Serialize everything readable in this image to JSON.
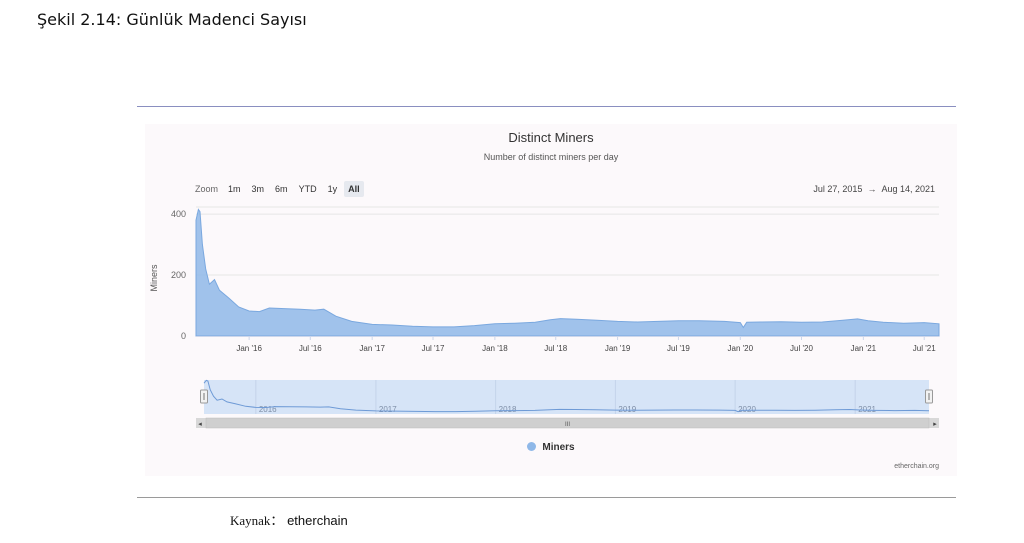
{
  "figure": {
    "caption": "Şekil 2.14: Günlük Madenci Sayısı",
    "source_label": "Kaynak：",
    "source_name": "etherchain"
  },
  "chart_data": {
    "type": "area",
    "title": "Distinct Miners",
    "subtitle": "Number of distinct miners per day",
    "xlabel": "",
    "ylabel": "Miners",
    "yticks": [
      "0",
      "200",
      "400"
    ],
    "ylim": [
      0,
      420
    ],
    "xlim": [
      "2015-07-27",
      "2021-08-14"
    ],
    "xticks": [
      {
        "label": "Jan '16",
        "x": "2016-01-01"
      },
      {
        "label": "Jul '16",
        "x": "2016-07-01"
      },
      {
        "label": "Jan '17",
        "x": "2017-01-01"
      },
      {
        "label": "Jul '17",
        "x": "2017-07-01"
      },
      {
        "label": "Jan '18",
        "x": "2018-01-01"
      },
      {
        "label": "Jul '18",
        "x": "2018-07-01"
      },
      {
        "label": "Jan '19",
        "x": "2019-01-01"
      },
      {
        "label": "Jul '19",
        "x": "2019-07-01"
      },
      {
        "label": "Jan '20",
        "x": "2020-01-01"
      },
      {
        "label": "Jul '20",
        "x": "2020-07-01"
      },
      {
        "label": "Jan '21",
        "x": "2021-01-01"
      },
      {
        "label": "Jul '21",
        "x": "2021-07-01"
      }
    ],
    "navigator_years": [
      "2016",
      "2017",
      "2018",
      "2019",
      "2020",
      "2021"
    ],
    "series": [
      {
        "name": "Miners",
        "color": "#8fb8e8",
        "points": [
          [
            "2015-07-27",
            380
          ],
          [
            "2015-08-03",
            415
          ],
          [
            "2015-08-08",
            408
          ],
          [
            "2015-08-15",
            300
          ],
          [
            "2015-08-25",
            220
          ],
          [
            "2015-09-05",
            170
          ],
          [
            "2015-09-20",
            185
          ],
          [
            "2015-10-05",
            150
          ],
          [
            "2015-11-01",
            125
          ],
          [
            "2015-12-01",
            95
          ],
          [
            "2016-01-01",
            82
          ],
          [
            "2016-02-01",
            80
          ],
          [
            "2016-03-01",
            92
          ],
          [
            "2016-04-15",
            90
          ],
          [
            "2016-06-01",
            88
          ],
          [
            "2016-07-15",
            85
          ],
          [
            "2016-08-10",
            88
          ],
          [
            "2016-09-15",
            65
          ],
          [
            "2016-11-01",
            48
          ],
          [
            "2017-01-01",
            38
          ],
          [
            "2017-03-01",
            36
          ],
          [
            "2017-05-01",
            32
          ],
          [
            "2017-07-01",
            30
          ],
          [
            "2017-09-01",
            30
          ],
          [
            "2017-11-01",
            34
          ],
          [
            "2018-01-01",
            40
          ],
          [
            "2018-03-01",
            42
          ],
          [
            "2018-05-01",
            45
          ],
          [
            "2018-06-15",
            53
          ],
          [
            "2018-07-15",
            57
          ],
          [
            "2018-09-01",
            55
          ],
          [
            "2018-11-01",
            52
          ],
          [
            "2019-01-01",
            48
          ],
          [
            "2019-03-01",
            46
          ],
          [
            "2019-05-01",
            48
          ],
          [
            "2019-07-01",
            50
          ],
          [
            "2019-09-01",
            50
          ],
          [
            "2019-11-15",
            48
          ],
          [
            "2020-01-01",
            44
          ],
          [
            "2020-01-10",
            28
          ],
          [
            "2020-01-20",
            45
          ],
          [
            "2020-03-01",
            46
          ],
          [
            "2020-05-01",
            47
          ],
          [
            "2020-07-01",
            45
          ],
          [
            "2020-09-01",
            46
          ],
          [
            "2020-11-01",
            52
          ],
          [
            "2020-12-15",
            56
          ],
          [
            "2021-01-15",
            50
          ],
          [
            "2021-03-01",
            45
          ],
          [
            "2021-05-01",
            42
          ],
          [
            "2021-07-01",
            44
          ],
          [
            "2021-08-14",
            40
          ]
        ]
      }
    ],
    "legend": [
      "Miners"
    ],
    "legend_position": "bottom-center",
    "grid": true
  },
  "toolbar": {
    "zoom_label": "Zoom",
    "buttons": [
      "1m",
      "3m",
      "6m",
      "YTD",
      "1y",
      "All"
    ],
    "active": "All",
    "range_from": "Jul 27, 2015",
    "range_arrow": "→",
    "range_to": "Aug 14, 2021"
  },
  "credit": "etherchain.org",
  "navigator": {
    "scroll_thumb": "III",
    "left_arrow": "◂",
    "right_arrow": "▸"
  }
}
